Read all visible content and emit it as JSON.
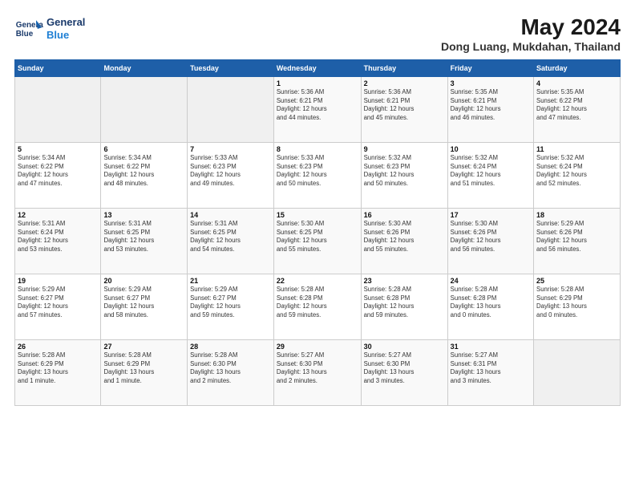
{
  "header": {
    "logo_line1": "General",
    "logo_line2": "Blue",
    "title": "May 2024",
    "subtitle": "Dong Luang, Mukdahan, Thailand"
  },
  "weekdays": [
    "Sunday",
    "Monday",
    "Tuesday",
    "Wednesday",
    "Thursday",
    "Friday",
    "Saturday"
  ],
  "weeks": [
    [
      {
        "day": "",
        "info": ""
      },
      {
        "day": "",
        "info": ""
      },
      {
        "day": "",
        "info": ""
      },
      {
        "day": "1",
        "info": "Sunrise: 5:36 AM\nSunset: 6:21 PM\nDaylight: 12 hours\nand 44 minutes."
      },
      {
        "day": "2",
        "info": "Sunrise: 5:36 AM\nSunset: 6:21 PM\nDaylight: 12 hours\nand 45 minutes."
      },
      {
        "day": "3",
        "info": "Sunrise: 5:35 AM\nSunset: 6:21 PM\nDaylight: 12 hours\nand 46 minutes."
      },
      {
        "day": "4",
        "info": "Sunrise: 5:35 AM\nSunset: 6:22 PM\nDaylight: 12 hours\nand 47 minutes."
      }
    ],
    [
      {
        "day": "5",
        "info": "Sunrise: 5:34 AM\nSunset: 6:22 PM\nDaylight: 12 hours\nand 47 minutes."
      },
      {
        "day": "6",
        "info": "Sunrise: 5:34 AM\nSunset: 6:22 PM\nDaylight: 12 hours\nand 48 minutes."
      },
      {
        "day": "7",
        "info": "Sunrise: 5:33 AM\nSunset: 6:23 PM\nDaylight: 12 hours\nand 49 minutes."
      },
      {
        "day": "8",
        "info": "Sunrise: 5:33 AM\nSunset: 6:23 PM\nDaylight: 12 hours\nand 50 minutes."
      },
      {
        "day": "9",
        "info": "Sunrise: 5:32 AM\nSunset: 6:23 PM\nDaylight: 12 hours\nand 50 minutes."
      },
      {
        "day": "10",
        "info": "Sunrise: 5:32 AM\nSunset: 6:24 PM\nDaylight: 12 hours\nand 51 minutes."
      },
      {
        "day": "11",
        "info": "Sunrise: 5:32 AM\nSunset: 6:24 PM\nDaylight: 12 hours\nand 52 minutes."
      }
    ],
    [
      {
        "day": "12",
        "info": "Sunrise: 5:31 AM\nSunset: 6:24 PM\nDaylight: 12 hours\nand 53 minutes."
      },
      {
        "day": "13",
        "info": "Sunrise: 5:31 AM\nSunset: 6:25 PM\nDaylight: 12 hours\nand 53 minutes."
      },
      {
        "day": "14",
        "info": "Sunrise: 5:31 AM\nSunset: 6:25 PM\nDaylight: 12 hours\nand 54 minutes."
      },
      {
        "day": "15",
        "info": "Sunrise: 5:30 AM\nSunset: 6:25 PM\nDaylight: 12 hours\nand 55 minutes."
      },
      {
        "day": "16",
        "info": "Sunrise: 5:30 AM\nSunset: 6:26 PM\nDaylight: 12 hours\nand 55 minutes."
      },
      {
        "day": "17",
        "info": "Sunrise: 5:30 AM\nSunset: 6:26 PM\nDaylight: 12 hours\nand 56 minutes."
      },
      {
        "day": "18",
        "info": "Sunrise: 5:29 AM\nSunset: 6:26 PM\nDaylight: 12 hours\nand 56 minutes."
      }
    ],
    [
      {
        "day": "19",
        "info": "Sunrise: 5:29 AM\nSunset: 6:27 PM\nDaylight: 12 hours\nand 57 minutes."
      },
      {
        "day": "20",
        "info": "Sunrise: 5:29 AM\nSunset: 6:27 PM\nDaylight: 12 hours\nand 58 minutes."
      },
      {
        "day": "21",
        "info": "Sunrise: 5:29 AM\nSunset: 6:27 PM\nDaylight: 12 hours\nand 59 minutes."
      },
      {
        "day": "22",
        "info": "Sunrise: 5:28 AM\nSunset: 6:28 PM\nDaylight: 12 hours\nand 59 minutes."
      },
      {
        "day": "23",
        "info": "Sunrise: 5:28 AM\nSunset: 6:28 PM\nDaylight: 12 hours\nand 59 minutes."
      },
      {
        "day": "24",
        "info": "Sunrise: 5:28 AM\nSunset: 6:28 PM\nDaylight: 13 hours\nand 0 minutes."
      },
      {
        "day": "25",
        "info": "Sunrise: 5:28 AM\nSunset: 6:29 PM\nDaylight: 13 hours\nand 0 minutes."
      }
    ],
    [
      {
        "day": "26",
        "info": "Sunrise: 5:28 AM\nSunset: 6:29 PM\nDaylight: 13 hours\nand 1 minute."
      },
      {
        "day": "27",
        "info": "Sunrise: 5:28 AM\nSunset: 6:29 PM\nDaylight: 13 hours\nand 1 minute."
      },
      {
        "day": "28",
        "info": "Sunrise: 5:28 AM\nSunset: 6:30 PM\nDaylight: 13 hours\nand 2 minutes."
      },
      {
        "day": "29",
        "info": "Sunrise: 5:27 AM\nSunset: 6:30 PM\nDaylight: 13 hours\nand 2 minutes."
      },
      {
        "day": "30",
        "info": "Sunrise: 5:27 AM\nSunset: 6:30 PM\nDaylight: 13 hours\nand 3 minutes."
      },
      {
        "day": "31",
        "info": "Sunrise: 5:27 AM\nSunset: 6:31 PM\nDaylight: 13 hours\nand 3 minutes."
      },
      {
        "day": "",
        "info": ""
      }
    ]
  ]
}
